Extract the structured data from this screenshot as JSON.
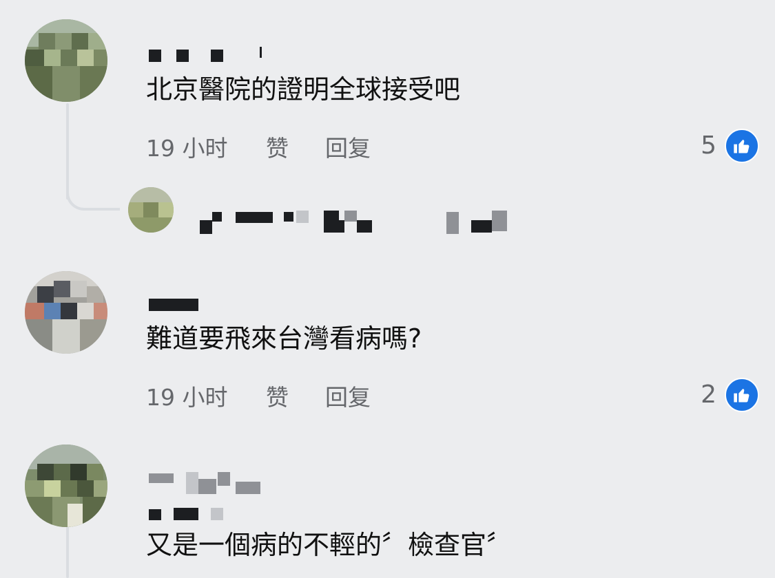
{
  "comments": [
    {
      "text": "北京醫院的證明全球接受吧",
      "time": "19 小时",
      "like_action": "赞",
      "reply_action": "回复",
      "like_count": "5"
    },
    {
      "text": "難道要飛來台灣看病嗎?",
      "time": "19 小时",
      "like_action": "赞",
      "reply_action": "回复",
      "like_count": "2"
    },
    {
      "text": "又是一個病的不輕的〞檢查官〞"
    }
  ],
  "colors": {
    "background": "#ecedef",
    "meta_text": "#65676b",
    "like_badge": "#1b74e4"
  },
  "icons": {
    "like_badge": "thumbs-up-icon",
    "avatar": "blurred-avatar"
  }
}
